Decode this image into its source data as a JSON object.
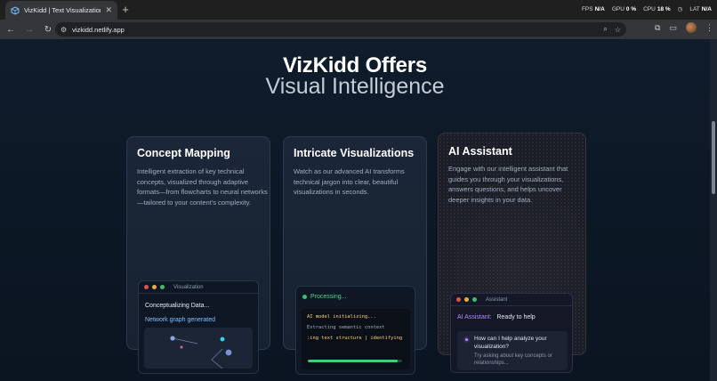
{
  "browser": {
    "tab_title": "VizKidd | Text Visualization",
    "tab_close": "✕",
    "new_tab": "+",
    "url": "vizkidd.netlify.app",
    "perf": [
      {
        "label": "FPS",
        "value": "N/A"
      },
      {
        "label": "GPU",
        "value": "0 %"
      },
      {
        "label": "CPU",
        "value": "18 %"
      },
      {
        "label": "LAT",
        "value": "N/A"
      }
    ]
  },
  "hero": {
    "title": "VizKidd Offers",
    "subtitle": "Visual Intelligence"
  },
  "cards": {
    "concept": {
      "title": "Concept Mapping",
      "desc": "Intelligent extraction of key technical concepts, visualized through adaptive formats—from flowcharts to neural networks —tailored to your content's complexity.",
      "window_label": "Visualization",
      "line1": "Conceptualizing Data...",
      "line2": "Network graph generated"
    },
    "intricate": {
      "title": "Intricate Visualizations",
      "desc": "Watch as our advanced AI transforms technical jargon into clear, beautiful visualizations in seconds.",
      "status": "Processing...",
      "term_lines": [
        "AI model initializing...",
        "Extracting semantic context",
        ":ing text structure | identifying I"
      ],
      "progress": 0.95
    },
    "assistant": {
      "title": "AI Assistant",
      "desc": "Engage with our intelligent assistant that guides you through your visualizations, answers questions, and helps uncover deeper insights in your data.",
      "window_label": "Assistant",
      "ai_label": "AI Assistant:",
      "ai_status": "Ready to help",
      "question": "How can I help analyze your visualization?",
      "hint": "Try asking about key concepts or relationships..."
    }
  },
  "colors": {
    "accent_green": "#3ccf7a",
    "accent_purple": "#b389ff",
    "accent_blue": "#7cc0ff"
  }
}
